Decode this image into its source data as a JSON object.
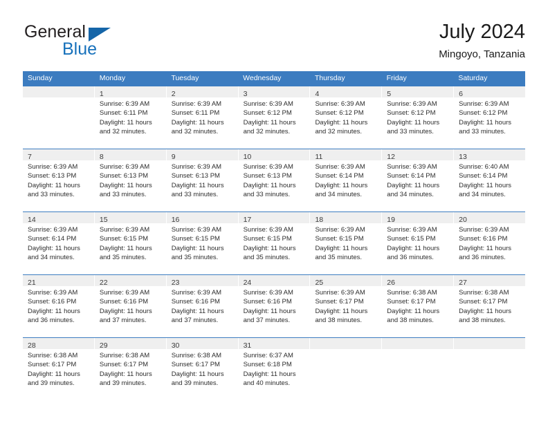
{
  "brand": {
    "name_top": "General",
    "name_bottom": "Blue",
    "accent_color": "#1771bb",
    "triangle_color": "#1565a8"
  },
  "header": {
    "title": "July 2024",
    "subtitle": "Mingoyo, Tanzania"
  },
  "theme": {
    "header_blue": "#3c7cc0",
    "day_strip_gray": "#efefef",
    "text_color": "#2c2c2c"
  },
  "weekdays": [
    "Sunday",
    "Monday",
    "Tuesday",
    "Wednesday",
    "Thursday",
    "Friday",
    "Saturday"
  ],
  "weeks": [
    [
      {
        "day": "",
        "sunrise": "",
        "sunset": "",
        "daylight_1": "",
        "daylight_2": "",
        "empty": true
      },
      {
        "day": "1",
        "sunrise": "Sunrise: 6:39 AM",
        "sunset": "Sunset: 6:11 PM",
        "daylight_1": "Daylight: 11 hours",
        "daylight_2": "and 32 minutes."
      },
      {
        "day": "2",
        "sunrise": "Sunrise: 6:39 AM",
        "sunset": "Sunset: 6:11 PM",
        "daylight_1": "Daylight: 11 hours",
        "daylight_2": "and 32 minutes."
      },
      {
        "day": "3",
        "sunrise": "Sunrise: 6:39 AM",
        "sunset": "Sunset: 6:12 PM",
        "daylight_1": "Daylight: 11 hours",
        "daylight_2": "and 32 minutes."
      },
      {
        "day": "4",
        "sunrise": "Sunrise: 6:39 AM",
        "sunset": "Sunset: 6:12 PM",
        "daylight_1": "Daylight: 11 hours",
        "daylight_2": "and 32 minutes."
      },
      {
        "day": "5",
        "sunrise": "Sunrise: 6:39 AM",
        "sunset": "Sunset: 6:12 PM",
        "daylight_1": "Daylight: 11 hours",
        "daylight_2": "and 33 minutes."
      },
      {
        "day": "6",
        "sunrise": "Sunrise: 6:39 AM",
        "sunset": "Sunset: 6:12 PM",
        "daylight_1": "Daylight: 11 hours",
        "daylight_2": "and 33 minutes."
      }
    ],
    [
      {
        "day": "7",
        "sunrise": "Sunrise: 6:39 AM",
        "sunset": "Sunset: 6:13 PM",
        "daylight_1": "Daylight: 11 hours",
        "daylight_2": "and 33 minutes."
      },
      {
        "day": "8",
        "sunrise": "Sunrise: 6:39 AM",
        "sunset": "Sunset: 6:13 PM",
        "daylight_1": "Daylight: 11 hours",
        "daylight_2": "and 33 minutes."
      },
      {
        "day": "9",
        "sunrise": "Sunrise: 6:39 AM",
        "sunset": "Sunset: 6:13 PM",
        "daylight_1": "Daylight: 11 hours",
        "daylight_2": "and 33 minutes."
      },
      {
        "day": "10",
        "sunrise": "Sunrise: 6:39 AM",
        "sunset": "Sunset: 6:13 PM",
        "daylight_1": "Daylight: 11 hours",
        "daylight_2": "and 33 minutes."
      },
      {
        "day": "11",
        "sunrise": "Sunrise: 6:39 AM",
        "sunset": "Sunset: 6:14 PM",
        "daylight_1": "Daylight: 11 hours",
        "daylight_2": "and 34 minutes."
      },
      {
        "day": "12",
        "sunrise": "Sunrise: 6:39 AM",
        "sunset": "Sunset: 6:14 PM",
        "daylight_1": "Daylight: 11 hours",
        "daylight_2": "and 34 minutes."
      },
      {
        "day": "13",
        "sunrise": "Sunrise: 6:40 AM",
        "sunset": "Sunset: 6:14 PM",
        "daylight_1": "Daylight: 11 hours",
        "daylight_2": "and 34 minutes."
      }
    ],
    [
      {
        "day": "14",
        "sunrise": "Sunrise: 6:39 AM",
        "sunset": "Sunset: 6:14 PM",
        "daylight_1": "Daylight: 11 hours",
        "daylight_2": "and 34 minutes."
      },
      {
        "day": "15",
        "sunrise": "Sunrise: 6:39 AM",
        "sunset": "Sunset: 6:15 PM",
        "daylight_1": "Daylight: 11 hours",
        "daylight_2": "and 35 minutes."
      },
      {
        "day": "16",
        "sunrise": "Sunrise: 6:39 AM",
        "sunset": "Sunset: 6:15 PM",
        "daylight_1": "Daylight: 11 hours",
        "daylight_2": "and 35 minutes."
      },
      {
        "day": "17",
        "sunrise": "Sunrise: 6:39 AM",
        "sunset": "Sunset: 6:15 PM",
        "daylight_1": "Daylight: 11 hours",
        "daylight_2": "and 35 minutes."
      },
      {
        "day": "18",
        "sunrise": "Sunrise: 6:39 AM",
        "sunset": "Sunset: 6:15 PM",
        "daylight_1": "Daylight: 11 hours",
        "daylight_2": "and 35 minutes."
      },
      {
        "day": "19",
        "sunrise": "Sunrise: 6:39 AM",
        "sunset": "Sunset: 6:15 PM",
        "daylight_1": "Daylight: 11 hours",
        "daylight_2": "and 36 minutes."
      },
      {
        "day": "20",
        "sunrise": "Sunrise: 6:39 AM",
        "sunset": "Sunset: 6:16 PM",
        "daylight_1": "Daylight: 11 hours",
        "daylight_2": "and 36 minutes."
      }
    ],
    [
      {
        "day": "21",
        "sunrise": "Sunrise: 6:39 AM",
        "sunset": "Sunset: 6:16 PM",
        "daylight_1": "Daylight: 11 hours",
        "daylight_2": "and 36 minutes."
      },
      {
        "day": "22",
        "sunrise": "Sunrise: 6:39 AM",
        "sunset": "Sunset: 6:16 PM",
        "daylight_1": "Daylight: 11 hours",
        "daylight_2": "and 37 minutes."
      },
      {
        "day": "23",
        "sunrise": "Sunrise: 6:39 AM",
        "sunset": "Sunset: 6:16 PM",
        "daylight_1": "Daylight: 11 hours",
        "daylight_2": "and 37 minutes."
      },
      {
        "day": "24",
        "sunrise": "Sunrise: 6:39 AM",
        "sunset": "Sunset: 6:16 PM",
        "daylight_1": "Daylight: 11 hours",
        "daylight_2": "and 37 minutes."
      },
      {
        "day": "25",
        "sunrise": "Sunrise: 6:39 AM",
        "sunset": "Sunset: 6:17 PM",
        "daylight_1": "Daylight: 11 hours",
        "daylight_2": "and 38 minutes."
      },
      {
        "day": "26",
        "sunrise": "Sunrise: 6:38 AM",
        "sunset": "Sunset: 6:17 PM",
        "daylight_1": "Daylight: 11 hours",
        "daylight_2": "and 38 minutes."
      },
      {
        "day": "27",
        "sunrise": "Sunrise: 6:38 AM",
        "sunset": "Sunset: 6:17 PM",
        "daylight_1": "Daylight: 11 hours",
        "daylight_2": "and 38 minutes."
      }
    ],
    [
      {
        "day": "28",
        "sunrise": "Sunrise: 6:38 AM",
        "sunset": "Sunset: 6:17 PM",
        "daylight_1": "Daylight: 11 hours",
        "daylight_2": "and 39 minutes."
      },
      {
        "day": "29",
        "sunrise": "Sunrise: 6:38 AM",
        "sunset": "Sunset: 6:17 PM",
        "daylight_1": "Daylight: 11 hours",
        "daylight_2": "and 39 minutes."
      },
      {
        "day": "30",
        "sunrise": "Sunrise: 6:38 AM",
        "sunset": "Sunset: 6:17 PM",
        "daylight_1": "Daylight: 11 hours",
        "daylight_2": "and 39 minutes."
      },
      {
        "day": "31",
        "sunrise": "Sunrise: 6:37 AM",
        "sunset": "Sunset: 6:18 PM",
        "daylight_1": "Daylight: 11 hours",
        "daylight_2": "and 40 minutes."
      },
      {
        "day": "",
        "sunrise": "",
        "sunset": "",
        "daylight_1": "",
        "daylight_2": "",
        "empty": true
      },
      {
        "day": "",
        "sunrise": "",
        "sunset": "",
        "daylight_1": "",
        "daylight_2": "",
        "empty": true
      },
      {
        "day": "",
        "sunrise": "",
        "sunset": "",
        "daylight_1": "",
        "daylight_2": "",
        "empty": true
      }
    ]
  ]
}
